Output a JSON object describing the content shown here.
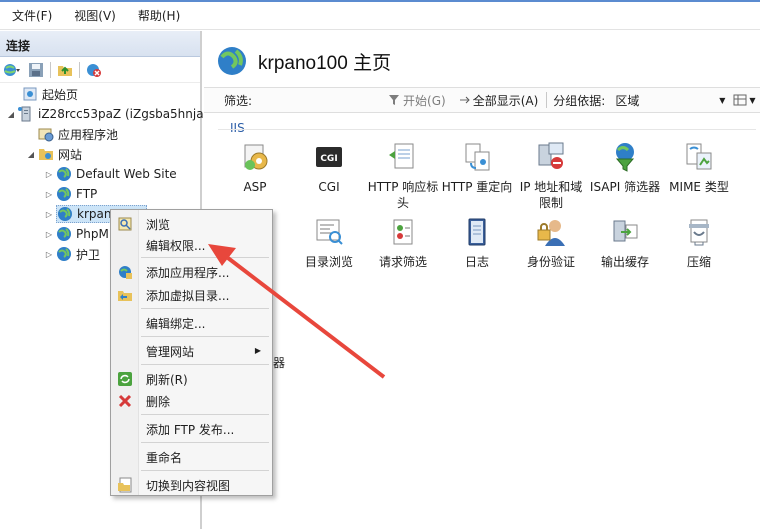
{
  "menubar": {
    "items": [
      "文件(F)",
      "视图(V)",
      "帮助(H)"
    ]
  },
  "connections": {
    "header": "连接",
    "tree": {
      "start_page": "起始页",
      "server": "iZ28rcc53paZ (iZgsba5hnja",
      "app_pools": "应用程序池",
      "sites": "网站",
      "site_items": [
        "Default Web Site",
        "FTP",
        "krpano100",
        "PhpM",
        "护卫"
      ]
    }
  },
  "main": {
    "title": "krpano100 主页",
    "filter": {
      "label": "筛选:",
      "start_button": "开始(G)",
      "show_all_button": "全部显示(A)",
      "group_by_label": "分组依据:",
      "group_by_value": "区域"
    },
    "section_label": "IIS",
    "features_row1": [
      "ASP",
      "CGI",
      "HTTP 响应标头",
      "HTTP 重定向",
      "IP 地址和域限制",
      "ISAPI 筛选器",
      "MIME 类型"
    ],
    "features_row2": [
      "档",
      "目录浏览",
      "请求筛选",
      "日志",
      "身份验证",
      "输出缓存",
      "压缩"
    ],
    "partial_label": "器"
  },
  "context_menu": {
    "items": [
      "浏览",
      "编辑权限...",
      "添加应用程序...",
      "添加虚拟目录...",
      "编辑绑定...",
      "管理网站",
      "刷新(R)",
      "删除",
      "添加 FTP 发布...",
      "重命名",
      "切换到内容视图"
    ]
  },
  "colors": {
    "accent": "#5b8bd0",
    "arrow": "#e8473c",
    "selection": "#cce4f7"
  }
}
